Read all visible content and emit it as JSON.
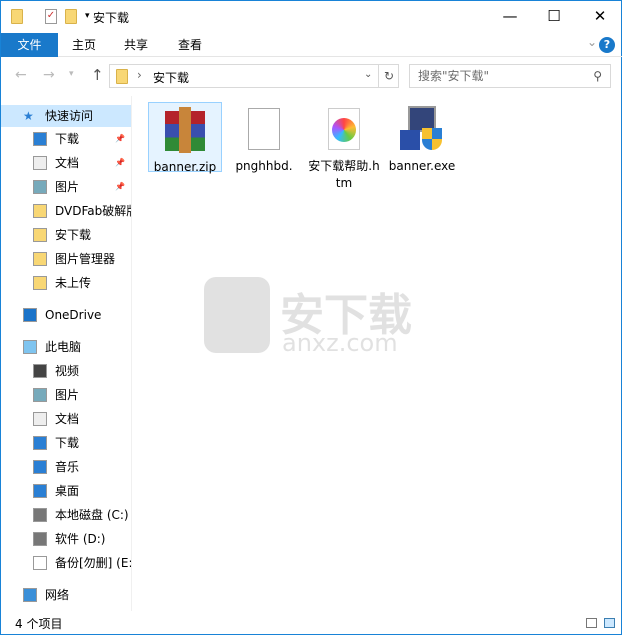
{
  "window": {
    "title": "安下载",
    "minimize": "—",
    "maximize": "☐",
    "close": "✕"
  },
  "ribbon": {
    "tabs": [
      "文件",
      "主页",
      "共享",
      "查看"
    ],
    "help": "?",
    "expand": "⌄"
  },
  "address": {
    "path": "安下载",
    "sep": "›",
    "search_placeholder": "搜索\"安下载\""
  },
  "nav": {
    "items": [
      {
        "label": "快速访问",
        "icon": "star-icon"
      },
      {
        "label": "下载",
        "icon": "download-icon",
        "pinned": true
      },
      {
        "label": "文档",
        "icon": "document-icon",
        "pinned": true
      },
      {
        "label": "图片",
        "icon": "pictures-icon",
        "pinned": true
      },
      {
        "label": "DVDFab破解版",
        "icon": "folder-icon"
      },
      {
        "label": "安下载",
        "icon": "folder-icon"
      },
      {
        "label": "图片管理器",
        "icon": "folder-icon"
      },
      {
        "label": "未上传",
        "icon": "folder-icon"
      },
      {
        "label": "OneDrive",
        "icon": "cloud-icon"
      },
      {
        "label": "此电脑",
        "icon": "computer-icon"
      },
      {
        "label": "视频",
        "icon": "video-icon"
      },
      {
        "label": "图片",
        "icon": "pictures-icon"
      },
      {
        "label": "文档",
        "icon": "document-icon"
      },
      {
        "label": "下载",
        "icon": "download-icon"
      },
      {
        "label": "音乐",
        "icon": "music-icon"
      },
      {
        "label": "桌面",
        "icon": "desktop-icon"
      },
      {
        "label": "本地磁盘 (C:)",
        "icon": "drive-icon"
      },
      {
        "label": "软件 (D:)",
        "icon": "drive-icon"
      },
      {
        "label": "备份[勿删] (E:)",
        "icon": "file-icon"
      },
      {
        "label": "网络",
        "icon": "network-icon"
      }
    ]
  },
  "files": [
    {
      "name": "banner.zip",
      "icon": "winrar-archive-icon"
    },
    {
      "name": "pnghhbd.",
      "icon": "blank-file-icon"
    },
    {
      "name": "安下载帮助.htm",
      "icon": "html-file-icon"
    },
    {
      "name": "banner.exe",
      "icon": "installer-icon"
    }
  ],
  "status": {
    "count": "4 个项目"
  },
  "watermark": {
    "text": "安下载",
    "sub": "anxz.com"
  }
}
